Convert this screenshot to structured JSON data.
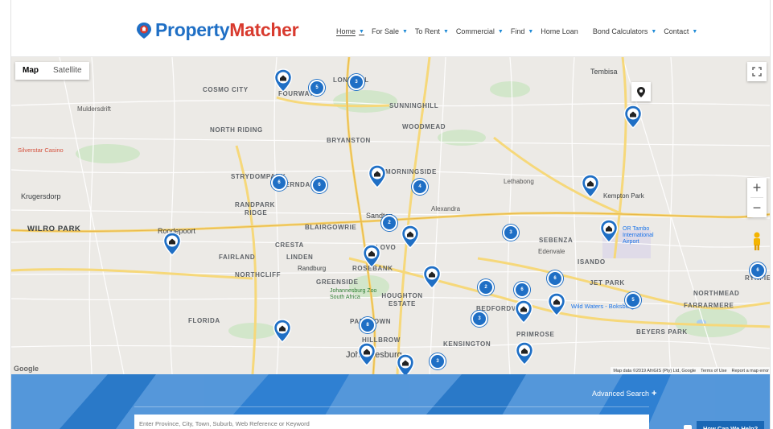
{
  "brand": {
    "part1": "Property",
    "part2": "Matcher",
    "blue": "#1f6fc5",
    "red": "#d83a2e"
  },
  "nav": [
    {
      "label": "Home",
      "caret": true,
      "active": true
    },
    {
      "label": "For Sale",
      "caret": true
    },
    {
      "label": "To Rent",
      "caret": true
    },
    {
      "label": "Commercial",
      "caret": true
    },
    {
      "label": "Find",
      "caret": true
    },
    {
      "label": "Home Loan",
      "caret": false
    },
    {
      "label": "Bond Calculators",
      "caret": true
    },
    {
      "label": "Contact",
      "caret": true
    }
  ],
  "map": {
    "type_control": {
      "map": "Map",
      "satellite": "Satellite"
    },
    "zoom_in": "+",
    "zoom_out": "−",
    "footer": {
      "data": "Map data ©2019 AfriGIS (Pty) Ltd, Google",
      "terms": "Terms of Use",
      "report": "Report a map error"
    },
    "google_logo": "Google",
    "places": {
      "cosmo": "COSMO CITY",
      "lonehill": "LONEHILL",
      "fourways": "FOURWAYS",
      "sunninghill": "SUNNINGHILL",
      "tembisa": "Tembisa",
      "muldersdrift": "Muldersdrift",
      "northriding": "NORTH RIDING",
      "woodmead": "WOODMEAD",
      "bryanston": "BRYANSTON",
      "silverstar": "Silverstar Casino",
      "krugersdorp": "Krugersdorp",
      "strydom": "STRYDOMPARK",
      "ferndale": "FERNDALE",
      "morningside": "MORNINGSIDE",
      "lethabong": "Lethabong",
      "kempton": "Kempton Park",
      "randpark": "RANDPARK",
      "ridge": "RIDGE",
      "alexandra": "Alexandra",
      "sandton": "Sandton",
      "wilropark": "WILRO PARK",
      "roodepoort": "Roodepoort",
      "blairgowrie": "BLAIRGOWRIE",
      "illovo": "ILLOVO",
      "sebenza": "SEBENZA",
      "edenvale": "Edenvale",
      "ortambo": "OR Tambo International Airport",
      "cresta": "CRESTA",
      "fairland": "FAIRLAND",
      "linden": "LINDEN",
      "randburg": "Randburg",
      "rosebank": "ROSEBANK",
      "isando": "ISANDO",
      "northcliff": "NORTHCLIFF",
      "greenside": "GREENSIDE",
      "jetpark": "JET PARK",
      "northmead": "NORTHMEAD",
      "zoo": "Johannesburg Zoo South Africa",
      "houghton": "HOUGHTON ESTATE",
      "bedfordview": "BEDFORDVIEW",
      "wildwaters": "Wild Waters - Boksburg",
      "farrarmere": "FARRARMERE",
      "florida": "FLORIDA",
      "parktown": "PARKTOWN",
      "primrose": "PRIMROSE",
      "beyerspark": "BEYERS PARK",
      "hillbrow": "HILLBROW",
      "kensington": "KENSINGTON",
      "johannesburg": "Johannesburg",
      "rynfield": "RYNFIE"
    },
    "clusters": [
      "3",
      "5",
      "6",
      "6",
      "4",
      "2",
      "3",
      "6",
      "2",
      "6",
      "8",
      "5",
      "3",
      "6",
      "3",
      "2"
    ]
  },
  "search": {
    "advanced_label": "Advanced Search",
    "advanced_icon": "+",
    "placeholder": "Enter Province, City, Town, Suburb, Web Reference or Keyword",
    "help_label": "How Can We Help?"
  }
}
